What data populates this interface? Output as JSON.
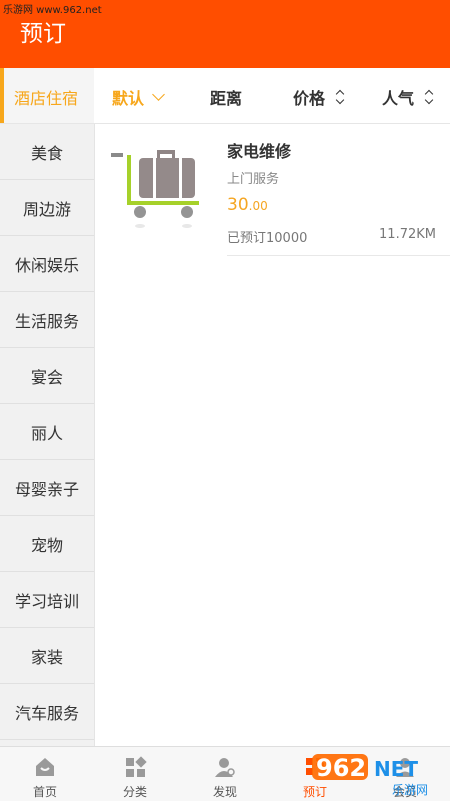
{
  "watermark": "乐游网 www.962.net",
  "header": {
    "title": "预订"
  },
  "filter": {
    "category": "酒店住宿",
    "default": "默认",
    "distance": "距离",
    "price": "价格",
    "popularity": "人气",
    "accent_color": "#f7a71c"
  },
  "sidebar": {
    "items": [
      {
        "label": "美食"
      },
      {
        "label": "周边游"
      },
      {
        "label": "休闲娱乐"
      },
      {
        "label": "生活服务"
      },
      {
        "label": "宴会"
      },
      {
        "label": "丽人"
      },
      {
        "label": "母婴亲子"
      },
      {
        "label": "宠物"
      },
      {
        "label": "学习培训"
      },
      {
        "label": "家装"
      },
      {
        "label": "汽车服务"
      }
    ]
  },
  "listing": {
    "title": "家电维修",
    "subtitle": "上门服务",
    "price_int": "30",
    "price_dec": ".00",
    "booked": "已预订10000",
    "distance": "11.72KM",
    "thumb_icon": "luggage-cart-icon"
  },
  "tabbar": {
    "items": [
      {
        "label": "首页",
        "icon": "home-icon"
      },
      {
        "label": "分类",
        "icon": "category-grid-icon"
      },
      {
        "label": "发现",
        "icon": "discover-icon"
      },
      {
        "label": "预订",
        "icon": "booking-icon"
      },
      {
        "label": "会员",
        "icon": "member-icon"
      }
    ],
    "active_color": "#ff4e00"
  },
  "logo": {
    "text": "962",
    "suffix": "NET",
    "caption": "乐游网"
  },
  "colors": {
    "brand": "#ff4e00"
  }
}
